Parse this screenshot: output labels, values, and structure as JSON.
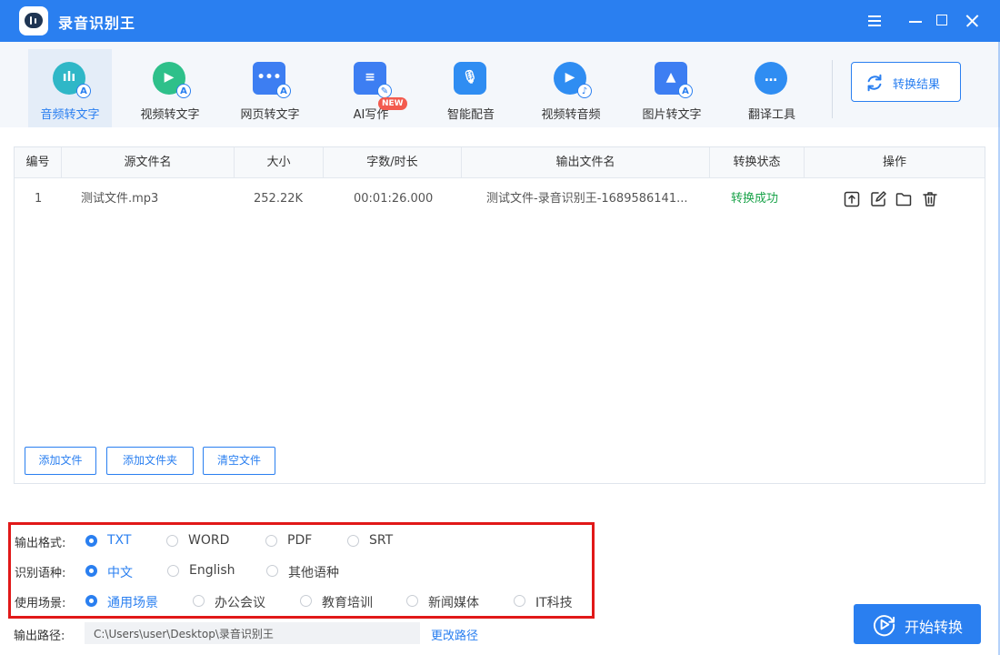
{
  "app": {
    "title": "录音识别王"
  },
  "toolbar": {
    "items": [
      {
        "label": "音频转文字",
        "icon": "audio-to-text-icon",
        "color": "#2fb7c7"
      },
      {
        "label": "视频转文字",
        "icon": "video-to-text-icon",
        "color": "#2ec08a"
      },
      {
        "label": "网页转文字",
        "icon": "webpage-to-text-icon",
        "color": "#3d7ef2"
      },
      {
        "label": "AI写作",
        "icon": "ai-writing-icon",
        "color": "#3d7ef2",
        "badge": "NEW"
      },
      {
        "label": "智能配音",
        "icon": "smart-dubbing-icon",
        "color": "#2f8df2"
      },
      {
        "label": "视频转音频",
        "icon": "video-to-audio-icon",
        "color": "#2f8df2"
      },
      {
        "label": "图片转文字",
        "icon": "image-to-text-icon",
        "color": "#3d7ef2"
      },
      {
        "label": "翻译工具",
        "icon": "translate-icon",
        "color": "#2f8df2"
      }
    ],
    "active_index": 0,
    "result_button": "转换结果"
  },
  "table": {
    "headers": [
      "编号",
      "源文件名",
      "大小",
      "字数/时长",
      "输出文件名",
      "转换状态",
      "操作"
    ],
    "rows": [
      {
        "index": "1",
        "source": "测试文件.mp3",
        "size": "252.22K",
        "duration": "00:01:26.000",
        "output": "测试文件-录音识别王-1689586141...",
        "status": "转换成功"
      }
    ],
    "actions": [
      "export-icon",
      "edit-icon",
      "folder-icon",
      "trash-icon"
    ]
  },
  "panel_buttons": {
    "add_file": "添加文件",
    "add_folder": "添加文件夹",
    "clear_files": "清空文件"
  },
  "options": {
    "format": {
      "label": "输出格式:",
      "choices": [
        "TXT",
        "WORD",
        "PDF",
        "SRT"
      ],
      "selected": "TXT"
    },
    "language": {
      "label": "识别语种:",
      "choices": [
        "中文",
        "English",
        "其他语种"
      ],
      "selected": "中文"
    },
    "scene": {
      "label": "使用场景:",
      "choices": [
        "通用场景",
        "办公会议",
        "教育培训",
        "新闻媒体",
        "IT科技"
      ],
      "selected": "通用场景"
    }
  },
  "output": {
    "label": "输出路径:",
    "path": "C:\\Users\\user\\Desktop\\录音识别王",
    "change_link": "更改路径"
  },
  "start_button": "开始转换",
  "colors": {
    "primary": "#2a7ff0",
    "success": "#1aa34a",
    "highlight_border": "#e11919"
  }
}
